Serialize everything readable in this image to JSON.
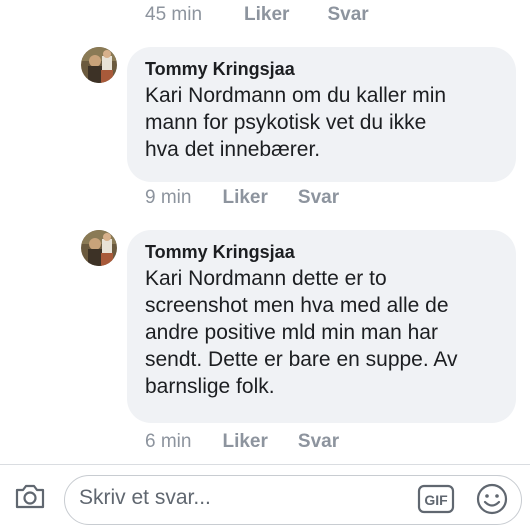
{
  "comments": [
    {
      "author": "",
      "text": "",
      "time": "45 min",
      "like_label": "Liker",
      "reply_label": "Svar"
    },
    {
      "author": "Tommy Kringsjaa",
      "text_lines": [
        "Kari Nordmann om du kaller min",
        "mann for psykotisk vet du ikke",
        "hva det innebærer."
      ],
      "time": "9 min",
      "like_label": "Liker",
      "reply_label": "Svar"
    },
    {
      "author": "Tommy Kringsjaa",
      "text_lines": [
        "Kari Nordmann dette er to",
        "screenshot men hva med alle de",
        "andre positive mld min man har",
        "sendt. Dette er bare en suppe. Av",
        "barnslige folk."
      ],
      "time": "6 min",
      "like_label": "Liker",
      "reply_label": "Svar"
    }
  ],
  "composer": {
    "placeholder": "Skriv et svar...",
    "camera_icon": "camera-icon",
    "gif_icon": "gif-icon",
    "gif_label": "GIF",
    "emoji_icon": "smiley-icon"
  },
  "colors": {
    "bubble": "#f0f2f5",
    "meta_text": "#8d949e",
    "author_text": "#1c1e21"
  }
}
